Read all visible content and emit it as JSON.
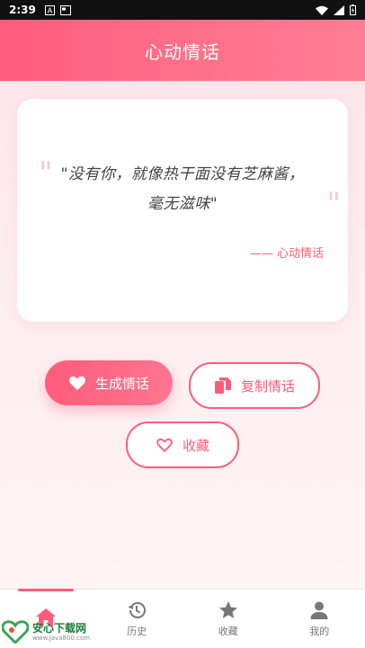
{
  "status_bar": {
    "time": "2:39",
    "left_icons": [
      "a-icon",
      "card-icon"
    ],
    "right_icons": [
      "wifi-icon",
      "signal-icon",
      "battery-icon"
    ]
  },
  "header": {
    "title": "心动情话"
  },
  "quote": {
    "text": "\"没有你，就像热干面没有芝麻酱，毫无滋味\"",
    "source": "—— 心动情话"
  },
  "actions": {
    "generate_label": "生成情话",
    "copy_label": "复制情话",
    "favorite_label": "收藏"
  },
  "bottom_nav": [
    {
      "label": "",
      "icon": "home-icon",
      "active": true
    },
    {
      "label": "历史",
      "icon": "history-icon",
      "active": false
    },
    {
      "label": "收藏",
      "icon": "star-icon",
      "active": false
    },
    {
      "label": "我的",
      "icon": "person-icon",
      "active": false
    }
  ],
  "watermark": {
    "title": "安心下载网",
    "url": "www.Java800.com"
  },
  "colors": {
    "accent": "#ff5c7a",
    "background": "#fdeef1",
    "status_bar": "#111111"
  }
}
